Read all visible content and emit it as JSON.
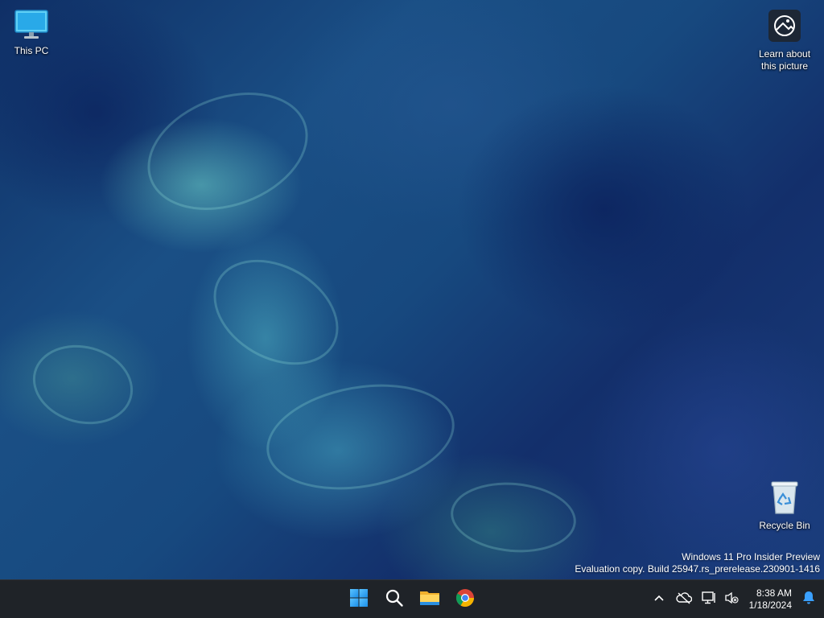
{
  "desktop": {
    "icons": [
      {
        "label": "This PC",
        "icon": "monitor-icon"
      },
      {
        "label": "Learn about\nthis picture",
        "icon": "camera-info-icon"
      },
      {
        "label": "Recycle Bin",
        "icon": "recycle-bin-icon"
      }
    ],
    "watermark": {
      "line1": "Windows 11 Pro Insider Preview",
      "line2": "Evaluation copy. Build 25947.rs_prerelease.230901-1416"
    }
  },
  "taskbar": {
    "pinned": [
      {
        "name": "Start",
        "icon": "windows-logo-icon"
      },
      {
        "name": "Search",
        "icon": "search-icon"
      },
      {
        "name": "File Explorer",
        "icon": "folder-icon"
      },
      {
        "name": "Google Chrome",
        "icon": "chrome-icon"
      }
    ],
    "tray": {
      "icons": [
        "chevron-up-icon",
        "onedrive-offline-icon",
        "network-icon",
        "volume-muted-icon"
      ],
      "time": "8:38 AM",
      "date": "1/18/2024",
      "notification_icon": "bell-icon"
    }
  },
  "colors": {
    "taskbar_bg": "#1f2328",
    "accent_blue": "#3aa0ff",
    "chrome_red": "#db4437",
    "chrome_green": "#0f9d58",
    "chrome_yellow": "#f4b400"
  }
}
